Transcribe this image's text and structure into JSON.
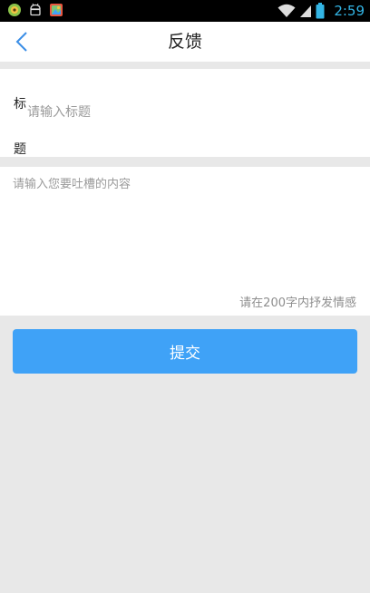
{
  "status_bar": {
    "time": "2:59",
    "left_icons": [
      "notification-app-icon",
      "android-icon",
      "gallery-app-icon"
    ],
    "right_icons": [
      "wifi-icon",
      "cell-signal-icon",
      "battery-icon"
    ]
  },
  "header": {
    "title": "反馈",
    "back_icon": "chevron-left-icon"
  },
  "form": {
    "title_label": "标题",
    "title_placeholder": "请输入标题",
    "content_placeholder": "请输入您要吐槽的内容",
    "content_hint": "请在200字内抒发情感"
  },
  "actions": {
    "submit_label": "提交"
  },
  "colors": {
    "accent": "#3fa2f7",
    "back_icon": "#3a8ee6",
    "clock": "#33b5e5",
    "background": "#e8e8e8"
  }
}
